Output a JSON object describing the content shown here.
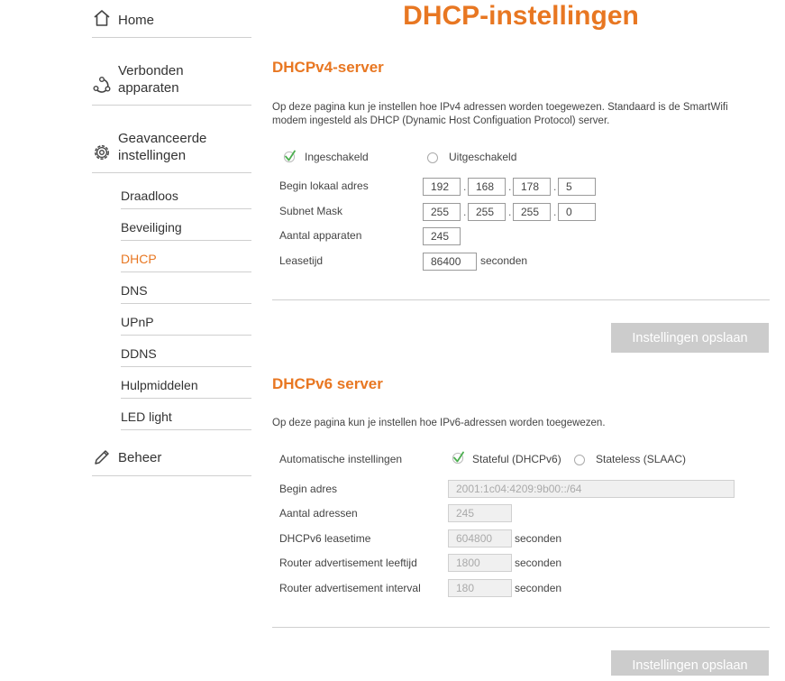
{
  "sidebar": {
    "home": "Home",
    "connected_devices": [
      "Verbonden",
      "apparaten"
    ],
    "advanced": [
      "Geavanceerde",
      "instellingen"
    ],
    "sub_items": [
      "Draadloos",
      "Beveiliging",
      "DHCP",
      "DNS",
      "UPnP",
      "DDNS",
      "Hulpmiddelen",
      "LED light"
    ],
    "active_item": "DHCP",
    "management": "Beheer"
  },
  "page_title": "DHCP-instellingen",
  "accent_color": "#e87722",
  "dhcpv4": {
    "title": "DHCPv4-server",
    "description": "Op deze pagina kun je instellen hoe IPv4 adressen worden toegewezen. Standaard is de SmartWifi modem ingesteld als DHCP (Dynamic Host Configuation Protocol) server.",
    "enabled_label": "Ingeschakeld",
    "disabled_label": "Uitgeschakeld",
    "selected": "Ingeschakeld",
    "begin_label": "Begin lokaal adres",
    "begin_octets": [
      "192",
      "168",
      "178",
      "5"
    ],
    "mask_label": "Subnet Mask",
    "mask_octets": [
      "255",
      "255",
      "255",
      "0"
    ],
    "devices_label": "Aantal apparaten",
    "devices_value": "245",
    "lease_label": "Leasetijd",
    "lease_value": "86400",
    "lease_unit": "seconden",
    "save_label": "Instellingen opslaan"
  },
  "dhcpv6": {
    "title": "DHCPv6 server",
    "description": "Op deze pagina kun je instellen hoe IPv6-adressen worden toegewezen.",
    "auto_label": "Automatische instellingen",
    "stateful_label": "Stateful (DHCPv6)",
    "stateless_label": "Stateless (SLAAC)",
    "selected": "Stateful (DHCPv6)",
    "begin_label": "Begin adres",
    "begin_value": "2001:1c04:4209:9b00::/64",
    "count_label": "Aantal adressen",
    "count_value": "245",
    "lease_label": "DHCPv6 leasetime",
    "lease_value": "604800",
    "lease_unit": "seconden",
    "adv_lifetime_label": "Router advertisement leeftijd",
    "adv_lifetime_value": "1800",
    "adv_lifetime_unit": "seconden",
    "adv_interval_label": "Router advertisement interval",
    "adv_interval_value": "180",
    "adv_interval_unit": "seconden",
    "save_label": "Instellingen opslaan"
  }
}
